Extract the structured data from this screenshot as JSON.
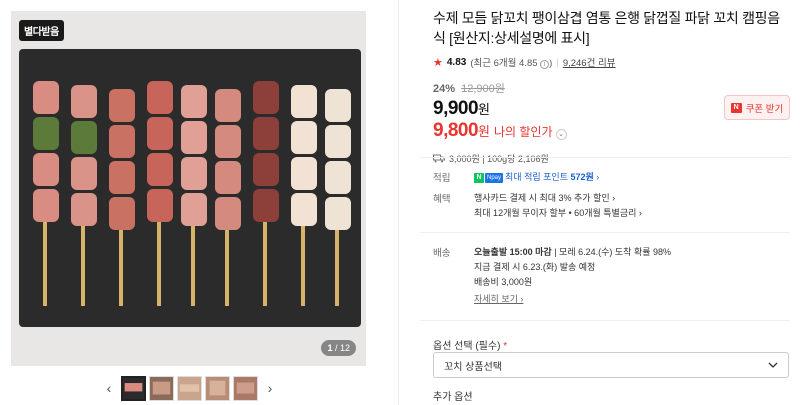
{
  "gallery": {
    "badge": "별다받음",
    "counter_current": "1",
    "counter_total": "/ 12",
    "prev_icon": "chevron-left-icon",
    "next_icon": "chevron-right-icon"
  },
  "product": {
    "title": "수제 모듬 닭꼬치 팽이삼겹 염통 은행 닭껍질 파닭 꼬치 캠핑음식 [원산지:상세설명에 표시]",
    "rating": "4.83",
    "rating_detail": "(최근 6개월 4.85",
    "rating_detail_end": ")",
    "review_count": "9,246건 리뷰",
    "discount_pct": "24%",
    "original_price": "12,900원",
    "price": "9,900",
    "price_unit": "원",
    "my_price": "9,800",
    "my_price_unit": "원",
    "my_price_label": "나의 할인가",
    "coupon_label": "쿠폰 받기",
    "shipping_summary": "3,000원 | 100g당 2,106원",
    "accent_color": "#e8352e"
  },
  "benefits": {
    "points_label": "적립",
    "points_text_prefix": "최대 적립 포인트 ",
    "points_value": "572원",
    "benefit_label": "혜택",
    "benefit_line1": "행사카드 결제 시 최대 3% 추가 할인 ›",
    "benefit_line2": "최대 12개월 무이자 할부 • 60개월 특별금리 ›"
  },
  "delivery": {
    "label": "배송",
    "line1_bold": "오늘출발 15:00 마감",
    "line1_rest": " | 모레 6.24.(수) 도착 확률 98%",
    "line2": "지금 결제 시 6.23.(화) 발송 예정",
    "line3": "배송비 3,000원",
    "details_link": "자세히 보기 ›"
  },
  "options": {
    "label": "옵션 선택 (필수)",
    "required_mark": "*",
    "select_value": "꼬치 상품선택",
    "additional_label": "추가 옵션"
  }
}
